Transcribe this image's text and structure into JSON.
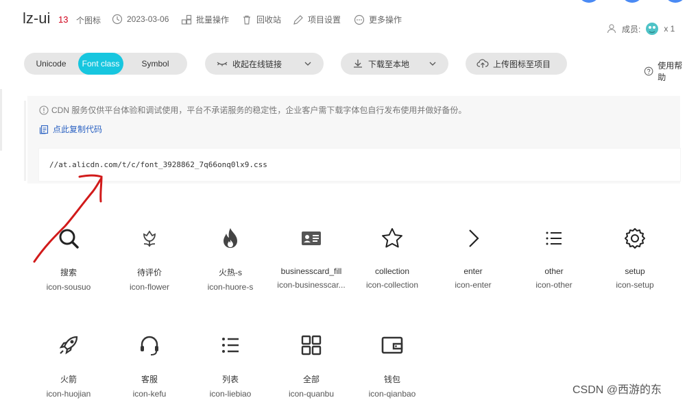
{
  "project": {
    "name": "lz-ui",
    "icon_count": "13",
    "icon_count_unit": "个图标",
    "date": "2023-03-06",
    "batch_label": "批量操作",
    "recycle_label": "回收站",
    "settings_label": "项目设置",
    "more_label": "更多操作",
    "members_label": "成员:",
    "members_count": "x 1"
  },
  "tabs": [
    "Unicode",
    "Font class",
    "Symbol"
  ],
  "toolbar": {
    "collapse_link": "收起在线链接",
    "download": "下载至本地",
    "upload": "上传图标至项目",
    "help": "使用帮助"
  },
  "notice": {
    "text": "CDN 服务仅供平台体验和调试使用，平台不承诺服务的稳定性，企业客户需下载字体包自行发布使用并做好备份。",
    "copy_label": "点此复制代码",
    "code": "//at.alicdn.com/t/c/font_3928862_7q66onq0lx9.css"
  },
  "icons": [
    {
      "name": "搜索",
      "cls": "icon-sousuo",
      "icon": "search-icon"
    },
    {
      "name": "待评价",
      "cls": "icon-flower",
      "icon": "flower-icon"
    },
    {
      "name": "火热-s",
      "cls": "icon-huore-s",
      "icon": "fire-icon"
    },
    {
      "name": "businesscard_fill",
      "cls": "icon-businesscar...",
      "icon": "business-card-icon"
    },
    {
      "name": "collection",
      "cls": "icon-collection",
      "icon": "star-icon"
    },
    {
      "name": "enter",
      "cls": "icon-enter",
      "icon": "chevron-right-icon"
    },
    {
      "name": "other",
      "cls": "icon-other",
      "icon": "list-icon"
    },
    {
      "name": "setup",
      "cls": "icon-setup",
      "icon": "gear-icon"
    },
    {
      "name": "火箭",
      "cls": "icon-huojian",
      "icon": "rocket-icon"
    },
    {
      "name": "客服",
      "cls": "icon-kefu",
      "icon": "headset-icon"
    },
    {
      "name": "列表",
      "cls": "icon-liebiao",
      "icon": "bullet-list-icon"
    },
    {
      "name": "全部",
      "cls": "icon-quanbu",
      "icon": "grid-icon"
    },
    {
      "name": "钱包",
      "cls": "icon-qianbao",
      "icon": "wallet-icon"
    }
  ],
  "watermark": "CSDN @西游的东"
}
